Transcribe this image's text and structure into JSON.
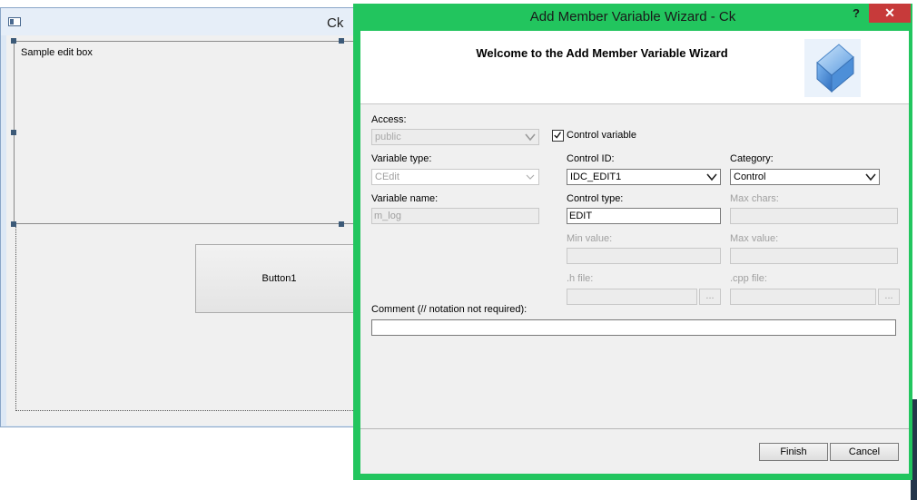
{
  "background_window": {
    "title": "Ck",
    "edit_box_label": "Sample edit box",
    "button_label": "Button1"
  },
  "wizard": {
    "title": "Add Member Variable Wizard - Ck",
    "help_label": "?",
    "close_label": "✕",
    "heading": "Welcome to the Add Member Variable Wizard",
    "logo_icon": "wizard-cube-icon",
    "access": {
      "label": "Access:",
      "value": "public"
    },
    "control_variable": {
      "label": "Control variable",
      "checked": true
    },
    "variable_type": {
      "label": "Variable type:",
      "value": "CEdit"
    },
    "variable_name": {
      "label": "Variable name:",
      "value": "m_log"
    },
    "control_id": {
      "label": "Control ID:",
      "value": "IDC_EDIT1"
    },
    "category": {
      "label": "Category:",
      "value": "Control"
    },
    "control_type": {
      "label": "Control type:",
      "value": "EDIT"
    },
    "max_chars": {
      "label": "Max chars:",
      "value": ""
    },
    "min_value": {
      "label": "Min value:",
      "value": ""
    },
    "max_value": {
      "label": "Max value:",
      "value": ""
    },
    "h_file": {
      "label": ".h file:",
      "value": "",
      "browse": "..."
    },
    "cpp_file": {
      "label": ".cpp file:",
      "value": "",
      "browse": "..."
    },
    "comment": {
      "label": "Comment (// notation not required):",
      "value": ""
    },
    "finish_label": "Finish",
    "cancel_label": "Cancel"
  },
  "colors": {
    "dialog_frame": "#22c55e",
    "close_button": "#c73a3a",
    "dialog_body": "#f0f0f0"
  }
}
